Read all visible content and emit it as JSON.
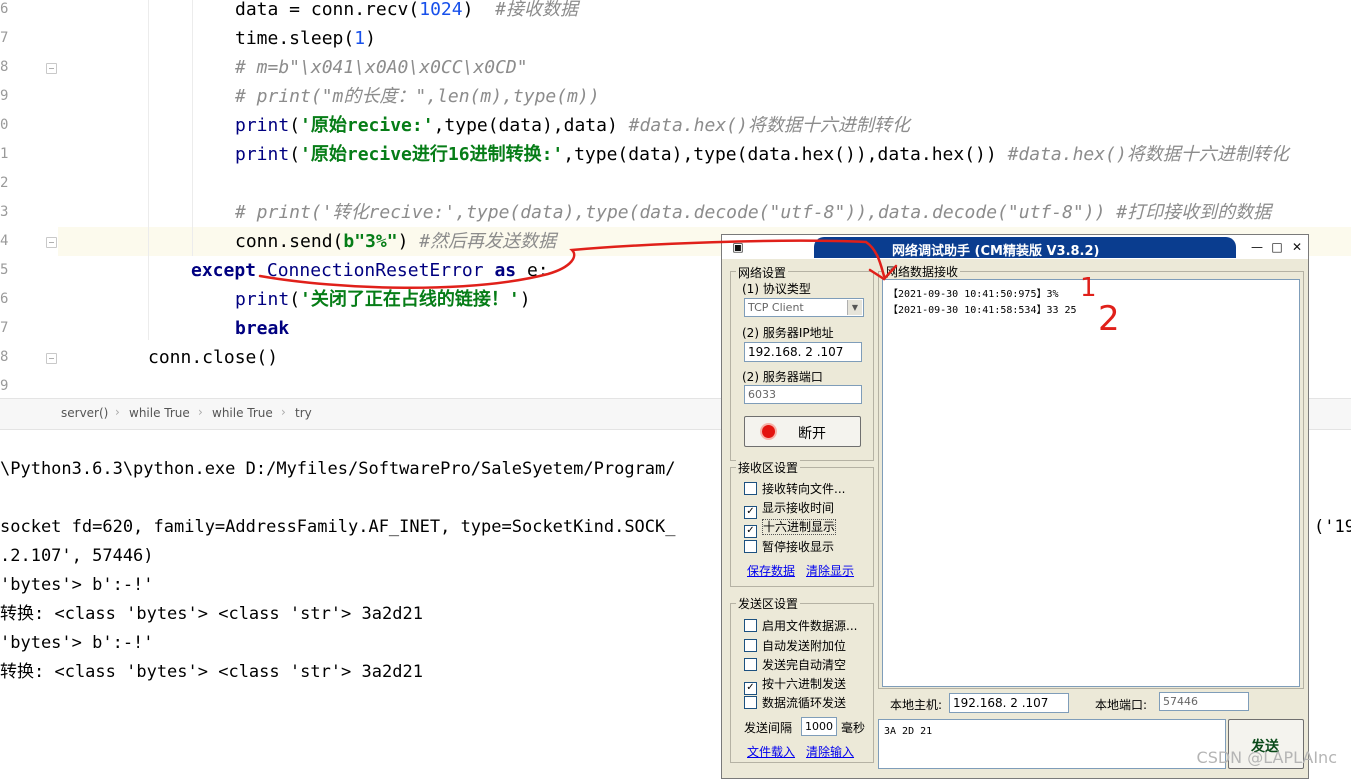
{
  "editor": {
    "line_numbers": [
      "6",
      "7",
      "8",
      "9",
      "0",
      "1",
      "2",
      "3",
      "4",
      "5",
      "6",
      "7",
      "8",
      "9"
    ],
    "lines": {
      "l1": {
        "code": "data = conn.recv(",
        "num": "1024",
        "close": ")",
        "comment": "  #接收数据"
      },
      "l2": {
        "code": "time.sleep(",
        "num": "1",
        "close": ")"
      },
      "l3": {
        "comment": "# m=b\"\\x041\\x0A0\\x0CC\\x0CD\""
      },
      "l4": {
        "comment": "# print(\"m的长度：\",len(m),type(m))"
      },
      "l5": {
        "fn": "print",
        "open": "(",
        "str": "'原始recive:'",
        "rest": ",type(data),data)",
        "comment": " #data.hex()将数据十六进制转化"
      },
      "l6": {
        "fn": "print",
        "open": "(",
        "str": "'原始recive进行16进制转换:'",
        "rest": ",type(data),type(data.hex()),data.hex())",
        "comment": " #data.hex()将数据十六进制转化"
      },
      "l8": {
        "comment": "# print('转化recive:',type(data),type(data.decode(\"utf-8\")),data.decode(\"utf-8\")) #打印接收到的数据"
      },
      "l9": {
        "code": "conn.send(",
        "str": "b\"3%\"",
        "close": ")",
        "comment": " #然后再发送数据"
      },
      "l10": {
        "kw": "except",
        "cls": " ConnectionResetError",
        "kw2": " as",
        "code": " e:"
      },
      "l11": {
        "fn": "print",
        "open": "(",
        "str": "'关闭了正在占线的链接！'",
        "close": ")"
      },
      "l12": {
        "kw": "break"
      },
      "l13": {
        "code": "conn.close()"
      }
    }
  },
  "breadcrumb": [
    "server()",
    "while True",
    "while True",
    "try"
  ],
  "console": [
    "\\Python3.6.3\\python.exe D:/Myfiles/SoftwarePro/SaleSyetem/Program/",
    "",
    "socket fd=620, family=AddressFamily.AF_INET, type=SocketKind.SOCK_",
    ".2.107', 57446)",
    "'bytes'> b':-!'",
    "转换: <class 'bytes'> <class 'str'> 3a2d21",
    "'bytes'> b':-!'",
    "转换: <class 'bytes'> <class 'str'> 3a2d21"
  ],
  "console_tail": "('19",
  "netwin": {
    "title": "网络调试助手 (CM精装版 V3.8.2)",
    "controls": {
      "minimize": "—",
      "maximize": "□",
      "close": "✕"
    },
    "net_settings": {
      "title": "网络设置",
      "protocol_label": "(1) 协议类型",
      "protocol_value": "TCP Client",
      "ip_label": "(2) 服务器IP地址",
      "ip_value": "192.168. 2 .107",
      "port_label": "(2) 服务器端口",
      "port_value": "6033",
      "disconnect_label": "断开"
    },
    "rx_settings": {
      "title": "接收区设置",
      "options": [
        {
          "label": "接收转向文件...",
          "checked": false
        },
        {
          "label": "显示接收时间",
          "checked": true
        },
        {
          "label": "十六进制显示",
          "checked": true
        },
        {
          "label": "暂停接收显示",
          "checked": false
        }
      ],
      "save_link": "保存数据",
      "clear_link": "清除显示"
    },
    "tx_settings": {
      "title": "发送区设置",
      "options": [
        {
          "label": "启用文件数据源...",
          "checked": false
        },
        {
          "label": "自动发送附加位",
          "checked": false
        },
        {
          "label": "发送完自动清空",
          "checked": false
        },
        {
          "label": "按十六进制发送",
          "checked": true
        },
        {
          "label": "数据流循环发送",
          "checked": false
        }
      ],
      "interval_label": "发送间隔",
      "interval_value": "1000",
      "interval_unit": "毫秒",
      "load_link": "文件载入",
      "clear_link": "清除输入"
    },
    "rx_area": {
      "title": "网络数据接收",
      "lines": [
        "【2021-09-30 10:41:50:975】3%",
        "【2021-09-30 10:41:58:534】33 25"
      ]
    },
    "local_host_label": "本地主机:",
    "local_host_value": "192.168. 2 .107",
    "local_port_label": "本地端口:",
    "local_port_value": "57446",
    "tx_input": "3A 2D 21",
    "send_label": "发送"
  },
  "watermark": "CSDN @LAPLAInc",
  "annotations": {
    "mark1": "1",
    "mark2": "2",
    "color": "#e0201a"
  }
}
